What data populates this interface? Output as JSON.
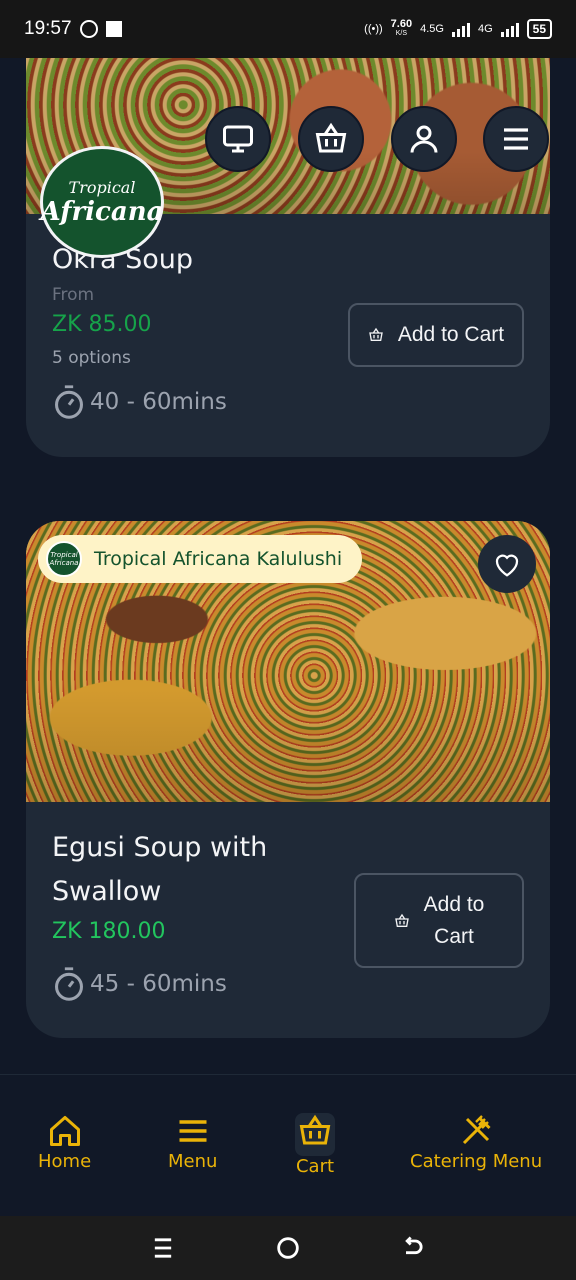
{
  "status_bar": {
    "time": "19:57",
    "speed_value": "7.60",
    "speed_unit": "K/S",
    "network1": "4.5G",
    "network2": "4G",
    "battery": "55"
  },
  "header": {
    "logo_line1": "Tropical",
    "logo_line2": "Africana",
    "icons": [
      "monitor-icon",
      "basket-icon",
      "user-icon",
      "menu-icon"
    ]
  },
  "products": [
    {
      "name": "Okra Soup",
      "from_label": "From",
      "price": "ZK 85.00",
      "options": "5 options",
      "time": "40 - 60mins",
      "cart_label": "Add to Cart"
    },
    {
      "restaurant": "Tropical Africana Kalulushi",
      "name_line1": "Egusi Soup with",
      "name_line2": "Swallow",
      "price": "ZK 180.00",
      "time": "45 - 60mins",
      "cart_line1": "Add to",
      "cart_line2": "Cart"
    }
  ],
  "bottom_nav": {
    "tabs": [
      {
        "label": "Home",
        "icon": "home-icon"
      },
      {
        "label": "Menu",
        "icon": "menu-icon"
      },
      {
        "label": "Cart",
        "icon": "basket-icon"
      },
      {
        "label": "Catering Menu",
        "icon": "utensils-icon"
      }
    ]
  },
  "colors": {
    "accent": "#eab308",
    "price_green": "#22c55e",
    "card_bg": "#1f2937",
    "page_bg": "#111827"
  }
}
